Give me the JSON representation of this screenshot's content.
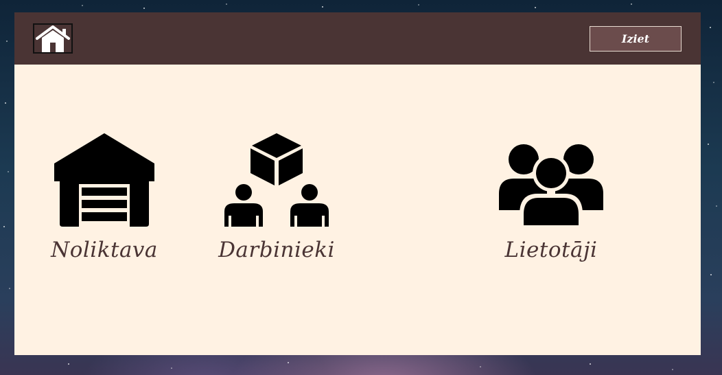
{
  "header": {
    "home_icon": "home-icon",
    "exit_label": "Iziet"
  },
  "menu": {
    "items": [
      {
        "label": "Noliktava",
        "icon": "garage-icon"
      },
      {
        "label": "Darbinieki",
        "icon": "employees-package-icon"
      },
      {
        "label": "Lietotāji",
        "icon": "users-group-icon"
      }
    ]
  },
  "colors": {
    "topbar": "#4a3434",
    "panel": "#fff2e3",
    "button": "#6b4c4c",
    "label": "#4a3434"
  }
}
